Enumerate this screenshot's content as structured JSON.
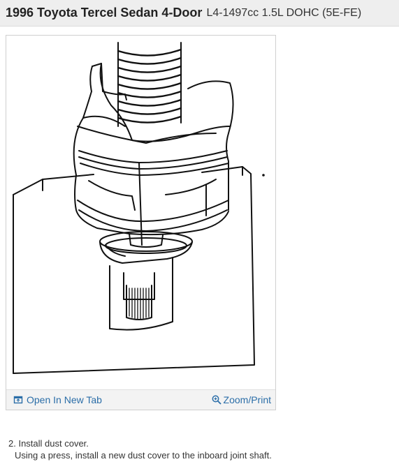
{
  "header": {
    "title": "1996 Toyota Tercel Sedan 4-Door",
    "subtitle": "L4-1497cc 1.5L DOHC (5E-FE)"
  },
  "figure": {
    "open_tab_label": "Open In New Tab",
    "zoom_label": "Zoom/Print",
    "link_color": "#2b6ea8"
  },
  "step": {
    "number": "2.",
    "title": "Install dust cover.",
    "detail": "Using a press, install a new dust cover to the inboard joint shaft."
  }
}
